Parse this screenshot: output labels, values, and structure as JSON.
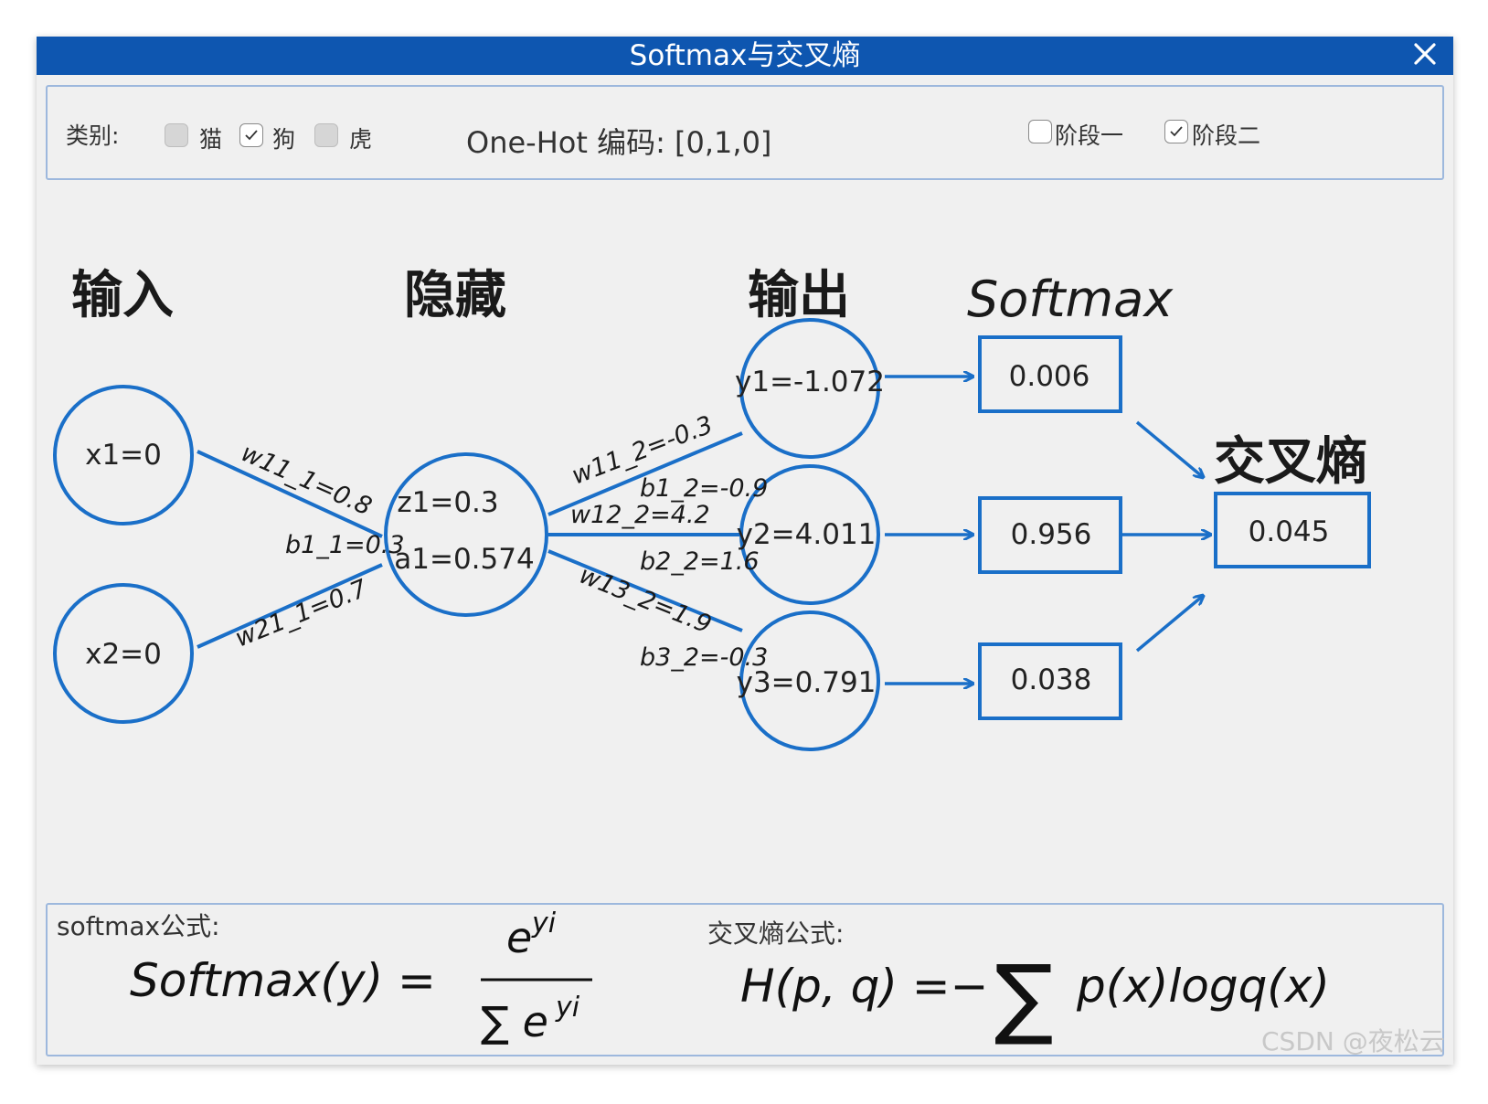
{
  "window": {
    "title": "Softmax与交叉熵",
    "accent_color": "#0e56b0"
  },
  "toolbar": {
    "category_label": "类别:",
    "categories": [
      {
        "label": "猫",
        "checked": false
      },
      {
        "label": "狗",
        "checked": true
      },
      {
        "label": "虎",
        "checked": false
      }
    ],
    "onehot_text": "One-Hot 编码: [0,1,0]",
    "stages": [
      {
        "label": "阶段一",
        "checked": false
      },
      {
        "label": "阶段二",
        "checked": true
      }
    ]
  },
  "diagram": {
    "headers": {
      "input": "输入",
      "hidden": "隐藏",
      "output": "输出",
      "softmax": "Softmax",
      "cross_entropy": "交叉熵"
    },
    "inputs": [
      "x1=0",
      "x2=0"
    ],
    "hidden": {
      "z": "z1=0.3",
      "a": "a1=0.574"
    },
    "outputs": [
      "y1=-1.072",
      "y2=4.011",
      "y3=0.791"
    ],
    "softmax_values": [
      "0.006",
      "0.956",
      "0.038"
    ],
    "cross_entropy_value": "0.045",
    "weights": {
      "w11_1": "w11_1=0.8",
      "b1_1": "b1_1=0.3",
      "w21_1": "w21_1=0.7",
      "w11_2": "w11_2=-0.3",
      "b1_2": "b1_2=-0.9",
      "w12_2": "w12_2=4.2",
      "b2_2": "b2_2=1.6",
      "w13_2": "w13_2=1.9",
      "b3_2": "b3_2=-0.3"
    },
    "line_color": "#1a6fc8"
  },
  "formulas": {
    "softmax_label": "softmax公式:",
    "softmax_lhs": "Softmax(y) =",
    "softmax_num": "e",
    "softmax_num_sup": "yi",
    "softmax_den": "∑ e",
    "softmax_den_sup": "yi",
    "ce_label": "交叉熵公式:",
    "ce_lhs": "H(p, q) =−",
    "ce_sum": "∑",
    "ce_rhs": "p(x)logq(x)"
  },
  "watermark": "CSDN @夜松云"
}
